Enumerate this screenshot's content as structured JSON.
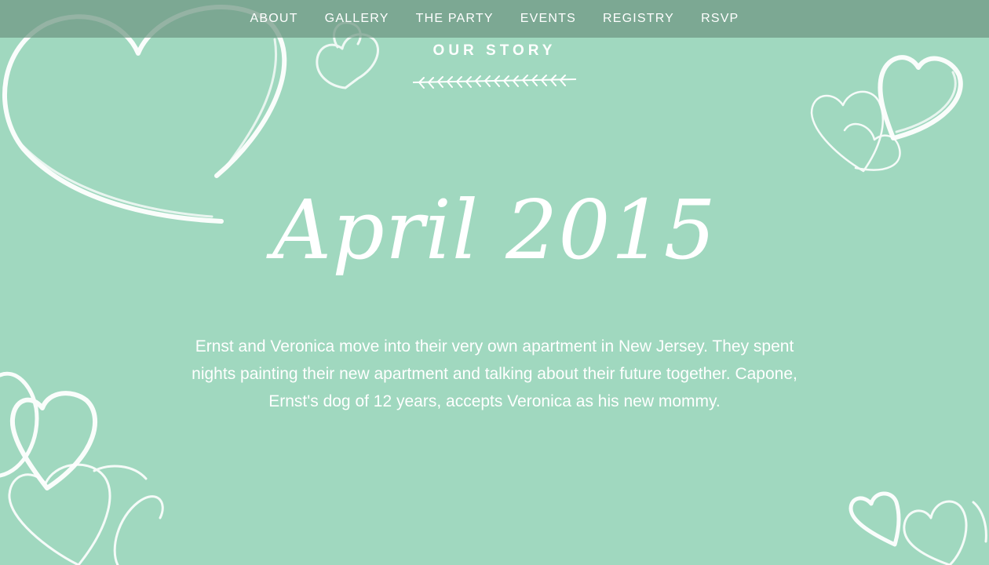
{
  "nav": {
    "items": [
      {
        "label": "ABOUT"
      },
      {
        "label": "GALLERY"
      },
      {
        "label": "THE PARTY"
      },
      {
        "label": "EVENTS"
      },
      {
        "label": "REGISTRY"
      },
      {
        "label": "RSVP"
      }
    ]
  },
  "section": {
    "title": "OUR STORY",
    "divider_icon": "fern-leaf-divider-icon"
  },
  "story": {
    "date": "April 2015",
    "text": "Ernst and Veronica move into their very own apartment in New Jersey. They spent nights painting their new apartment and talking about their future together. Capone, Ernst's dog of 12 years, accepts Veronica as his new mommy."
  },
  "colors": {
    "background": "#a0d8bf",
    "nav_bar": "#6e9682",
    "text": "#ffffff"
  },
  "decorations": [
    "heart-outline-icon"
  ]
}
